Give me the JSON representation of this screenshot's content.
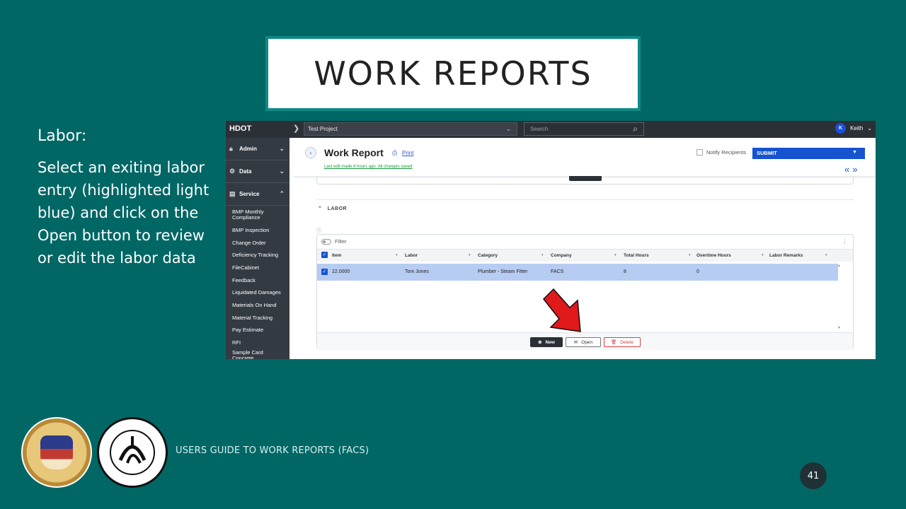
{
  "slide": {
    "title": "WORK REPORTS",
    "heading": "Labor:",
    "body": "Select an exiting labor entry (highlighted light blue) and click on the Open button to review or edit the labor data",
    "footer_text": "USERS GUIDE TO WORK REPORTS  (FACS)",
    "page_number": "41"
  },
  "app": {
    "brand": "HDOT",
    "project": "Test Project",
    "search_placeholder": "Search",
    "user_initial": "K",
    "user_name": "Keith",
    "sidebar": {
      "sections": [
        {
          "label": "Admin",
          "icon": "lock-icon"
        },
        {
          "label": "Data",
          "icon": "gear-icon"
        },
        {
          "label": "Service",
          "icon": "document-icon"
        }
      ],
      "items": [
        "BMP Monthly Compliance",
        "BMP Inspection",
        "Change Order",
        "Deficiency Tracking",
        "FileCabinet",
        "Feedback",
        "Liquidated Damages",
        "Materials On Hand",
        "Material Tracking",
        "Pay Estimate",
        "RFI",
        "Sample Card Concrete"
      ]
    },
    "header": {
      "title": "Work Report",
      "print": "Print",
      "last_edit": "Last edit made 4 hours ago. All changes saved",
      "notify": "Notify Recipients",
      "submit": "SUBMIT"
    },
    "labor": {
      "section_title": "LABOR",
      "filter": "Filter",
      "columns": [
        "Item",
        "Labor",
        "Category",
        "Company",
        "Total Hours",
        "Overtime Hours",
        "Labor Remarks"
      ],
      "rows": [
        {
          "item": "22.0000",
          "labor": "Tom Jones",
          "category": "Plumber - Steam Fitter",
          "company": "FACS",
          "total_hours": "8",
          "overtime_hours": "0",
          "remarks": ""
        }
      ],
      "buttons": {
        "new": "New",
        "open": "Open",
        "delete": "Delete"
      }
    },
    "colors": {
      "accent": "#1553d0",
      "highlight": "#b7ccf2",
      "arrow": "#e0191b"
    }
  }
}
